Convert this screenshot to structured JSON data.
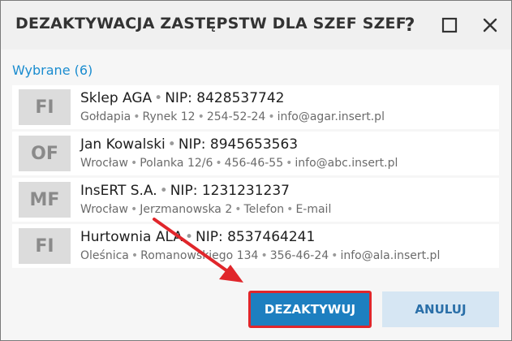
{
  "dialog": {
    "title": "DEZAKTYWACJA ZASTĘPSTW DLA SZEF SZEF",
    "help_label": "?"
  },
  "section": {
    "label": "Wybrane (6)"
  },
  "items": [
    {
      "badge": "FI",
      "name": "Sklep AGA",
      "nip": "NIP: 8428537742",
      "city": "Gołdapia",
      "street": "Rynek 12",
      "phone": "254-52-24",
      "email": "info@agar.insert.pl"
    },
    {
      "badge": "OF",
      "name": "Jan Kowalski",
      "nip": "NIP: 8945653563",
      "city": "Wrocław",
      "street": "Polanka  12/6",
      "phone": "456-46-55",
      "email": "info@abc.insert.pl"
    },
    {
      "badge": "MF",
      "name": "InsERT S.A.",
      "nip": "NIP: 1231231237",
      "city": "Wrocław",
      "street": "Jerzmanowska 2",
      "phone": "Telefon",
      "email": "E-mail"
    },
    {
      "badge": "FI",
      "name": "Hurtownia ALA",
      "nip": "NIP: 8537464241",
      "city": "Oleśnica",
      "street": "Romanowskiego 134",
      "phone": "356-46-24",
      "email": "info@ala.insert.pl"
    }
  ],
  "buttons": {
    "deactivate": "DEZAKTYWUJ",
    "cancel": "ANULUJ"
  },
  "colors": {
    "accent": "#1d7fc0",
    "highlight": "#e0262b",
    "section_label": "#1a8ccf"
  },
  "icons": [
    "help-icon",
    "maximize-icon",
    "close-icon",
    "pointer-arrow-icon"
  ]
}
